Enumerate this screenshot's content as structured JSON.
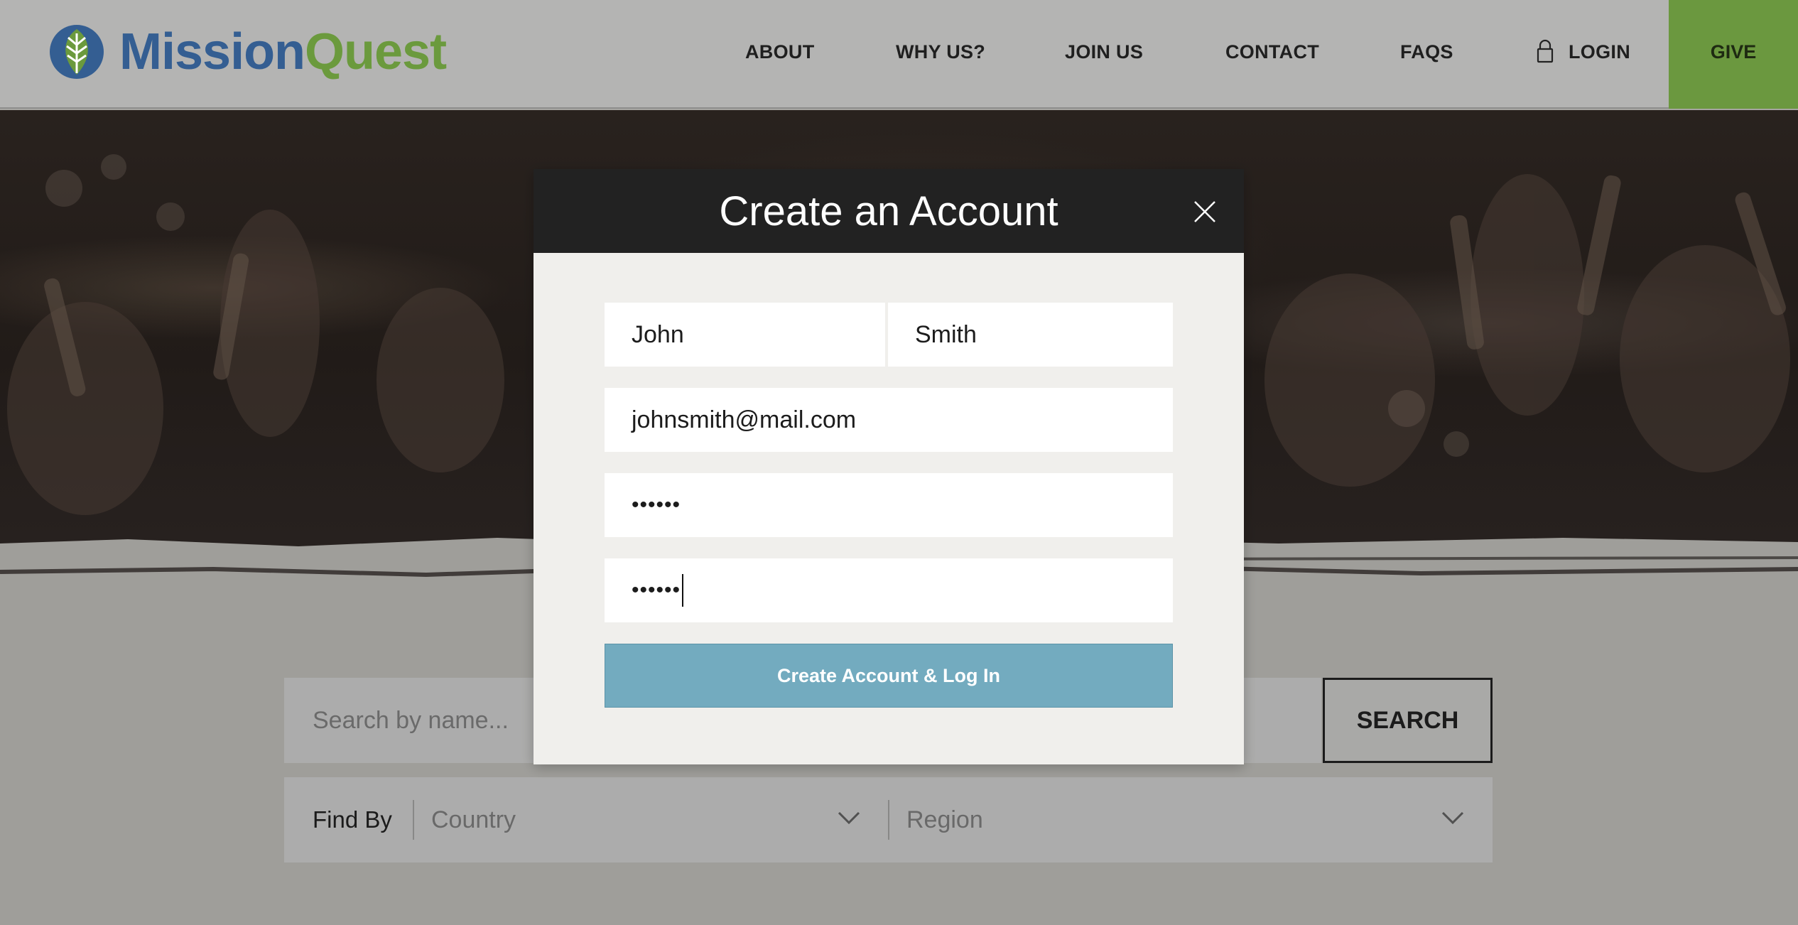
{
  "header": {
    "brand": {
      "part1": "Mission",
      "part2": "Quest"
    },
    "nav": [
      "ABOUT",
      "WHY US?",
      "JOIN US",
      "CONTACT",
      "FAQS"
    ],
    "login_label": "LOGIN",
    "give_label": "GIVE"
  },
  "modal": {
    "title": "Create an Account",
    "first_name": "John",
    "last_name": "Smith",
    "email": "johnsmith@mail.com",
    "password_mask": "••••••",
    "confirm_password_mask": "••••••",
    "submit_label": "Create Account & Log In"
  },
  "search": {
    "placeholder": "Search by name...",
    "button_label": "SEARCH",
    "findby_label": "Find By",
    "country_placeholder": "Country",
    "region_placeholder": "Region"
  },
  "colors": {
    "brand_blue": "#345e92",
    "brand_green": "#6b9a3d",
    "give_green": "#6b983f",
    "submit_blue": "#73abbf",
    "modal_header": "#222222"
  }
}
